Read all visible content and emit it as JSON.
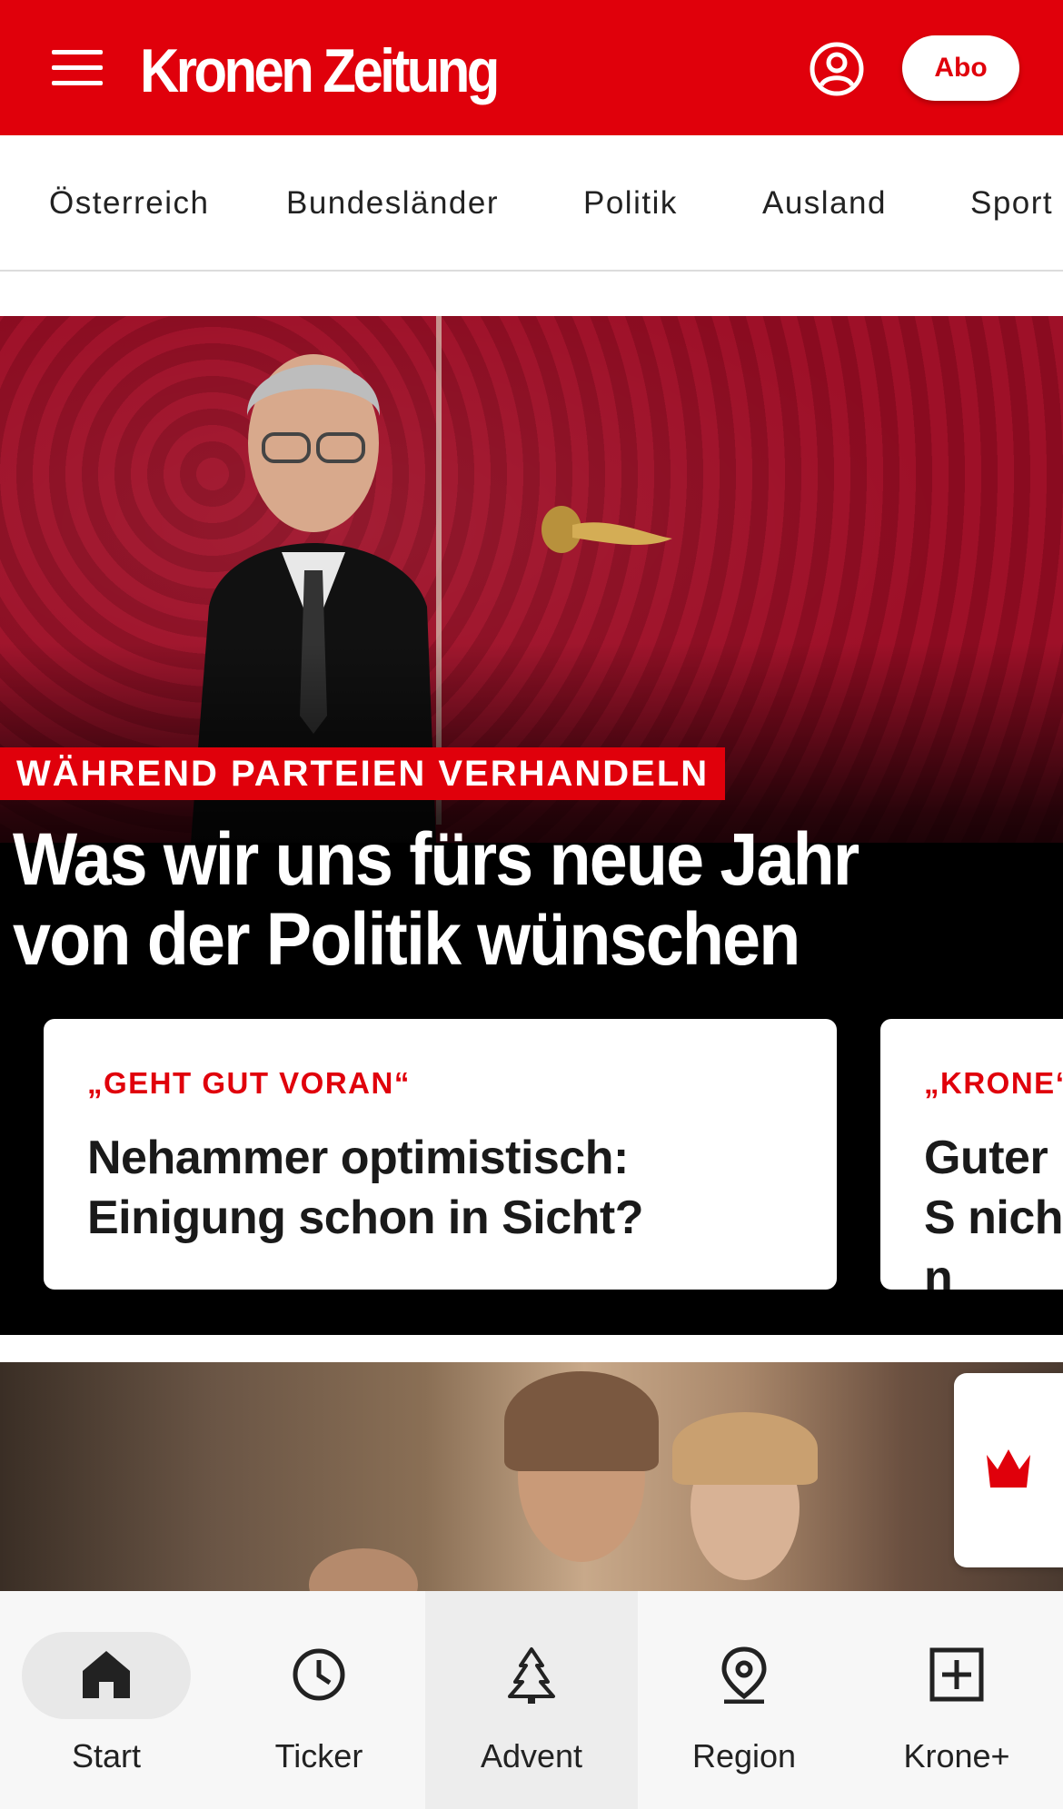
{
  "header": {
    "logo": "Kronen Zeitung",
    "abo_label": "Abo",
    "menu_icon": "hamburger-menu-icon",
    "account_icon": "user-circle-icon",
    "brand_color": "#e0000b"
  },
  "tabs": [
    "Österreich",
    "Bundesländer",
    "Politik",
    "Ausland",
    "Sport"
  ],
  "hero": {
    "kicker": "WÄHREND PARTEIEN VERHANDELN",
    "headline": "Was wir uns fürs neue Jahr von der Politik wünschen",
    "cards": [
      {
        "kicker": "„GEHT GUT VORAN“",
        "title": "Nehammer optimistisch: Einigung schon in Sicht?"
      },
      {
        "kicker": "„KRONE“",
        "title": "Guter S nicht n"
      }
    ]
  },
  "krone_plus_badge_icon": "crown-icon",
  "bottom_nav": [
    {
      "label": "Start",
      "icon": "home-icon",
      "active": true
    },
    {
      "label": "Ticker",
      "icon": "clock-icon",
      "active": false
    },
    {
      "label": "Advent",
      "icon": "tree-icon",
      "active": false
    },
    {
      "label": "Region",
      "icon": "location-pin-icon",
      "active": false
    },
    {
      "label": "Krone+",
      "icon": "plus-box-icon",
      "active": false
    }
  ]
}
